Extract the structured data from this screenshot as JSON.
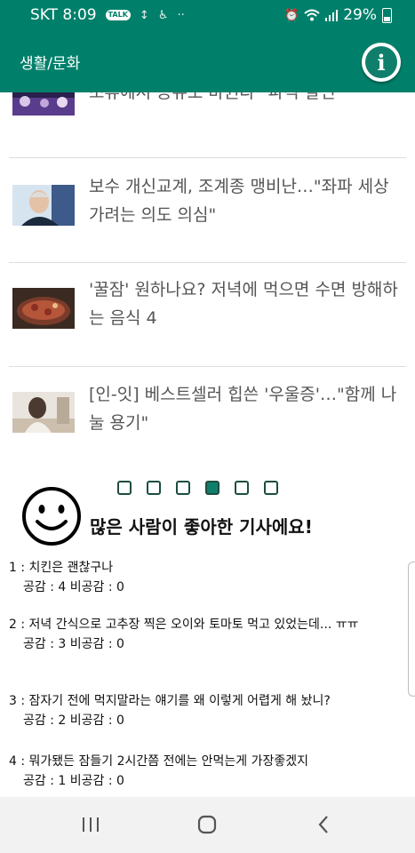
{
  "status": {
    "carrier_time": "SKT 8:09",
    "talk_badge": "TALK",
    "battery_text": "29%",
    "icons": [
      "kakaotalk-icon",
      "data-icon",
      "accessibility-icon",
      "more-icon",
      "alarm-icon",
      "wifi-icon",
      "signal-icon",
      "battery-icon"
    ]
  },
  "appbar": {
    "title": "생활/문화",
    "info_symbol": "i"
  },
  "articles": [
    {
      "headline": "조류에서 공유도 바뀐다\" 파격 발언"
    },
    {
      "headline": "보수 개신교계, 조계종 맹비난…\"좌파 세상가려는 의도 의심\""
    },
    {
      "headline": "'꿀잠' 원하나요? 저녁에 먹으면 수면 방해하는 음식 4"
    },
    {
      "headline": "[인-잇] 베스트셀러 힙쓴 '우울증'…\"함께 나눌 용기\""
    }
  ],
  "pager": {
    "count": 6,
    "active_index": 3
  },
  "popular_text": "많은 사람이 좋아한 기사에요!",
  "comments": [
    {
      "text": "1 : 치킨은 괜찮구나",
      "stats": "공감 : 4 비공감 : 0"
    },
    {
      "text": "2 : 저녁 간식으로 고추장 찍은 오이와 토마토 먹고 있었는데... ㅠㅠ",
      "stats": "공감 : 3 비공감 : 0"
    },
    {
      "text": "3 : 잠자기 전에 먹지말라는 얘기를 왜 이렇게 어렵게 해 놨니?",
      "stats": "공감 : 2 비공감 : 0"
    },
    {
      "text": "4 : 뭐가됐든 잠들기 2시간쯤 전에는 안먹는게 가장좋겠지",
      "stats": "공감 : 1 비공감 : 0"
    }
  ],
  "colors": {
    "primary": "#00806b",
    "active_dot": "#0f7f6c",
    "dot_border": "#1b4d40",
    "divider": "#dddddd",
    "navbar": "#f2f2f2"
  },
  "navbar": {
    "buttons": [
      "recent-apps-icon",
      "home-icon",
      "back-icon"
    ]
  }
}
